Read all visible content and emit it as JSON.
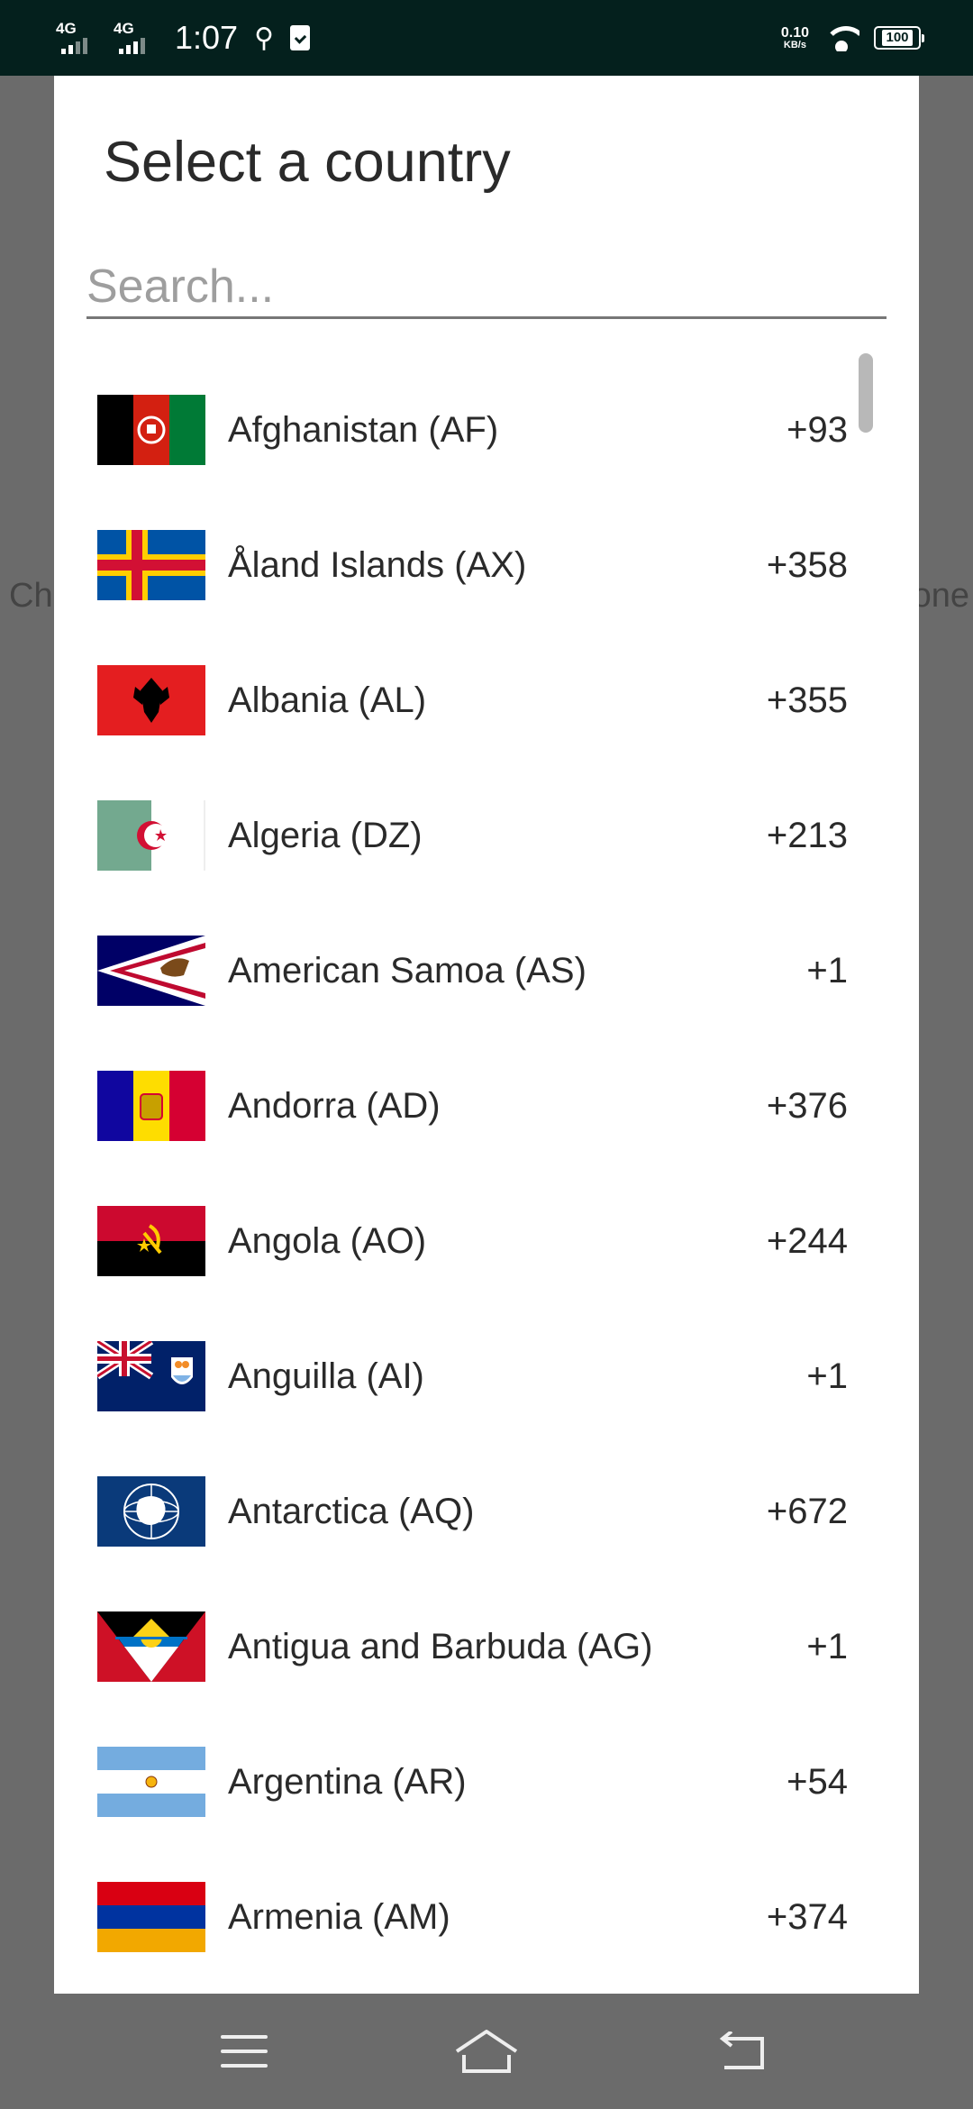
{
  "status_bar": {
    "sim1": "4G",
    "sim2": "4G",
    "time": "1:07",
    "net_speed_value": "0.10",
    "net_speed_unit": "KB/s",
    "battery": "100"
  },
  "background": {
    "left_text": "Ch",
    "right_text": "one"
  },
  "dialog": {
    "title": "Select a country",
    "search_placeholder": "Search..."
  },
  "countries": [
    {
      "name": "Afghanistan (AF)",
      "code": "+93",
      "flag": "af"
    },
    {
      "name": "Åland Islands (AX)",
      "code": "+358",
      "flag": "ax"
    },
    {
      "name": "Albania (AL)",
      "code": "+355",
      "flag": "al"
    },
    {
      "name": "Algeria (DZ)",
      "code": "+213",
      "flag": "dz"
    },
    {
      "name": "American Samoa (AS)",
      "code": "+1",
      "flag": "as"
    },
    {
      "name": "Andorra (AD)",
      "code": "+376",
      "flag": "ad"
    },
    {
      "name": "Angola (AO)",
      "code": "+244",
      "flag": "ao"
    },
    {
      "name": "Anguilla (AI)",
      "code": "+1",
      "flag": "ai"
    },
    {
      "name": "Antarctica (AQ)",
      "code": "+672",
      "flag": "aq"
    },
    {
      "name": "Antigua and Barbuda (AG)",
      "code": "+1",
      "flag": "ag"
    },
    {
      "name": "Argentina (AR)",
      "code": "+54",
      "flag": "ar"
    },
    {
      "name": "Armenia (AM)",
      "code": "+374",
      "flag": "am"
    }
  ],
  "nav": {
    "menu_icon": "menu-icon",
    "home_icon": "home-icon",
    "back_icon": "back-icon"
  }
}
